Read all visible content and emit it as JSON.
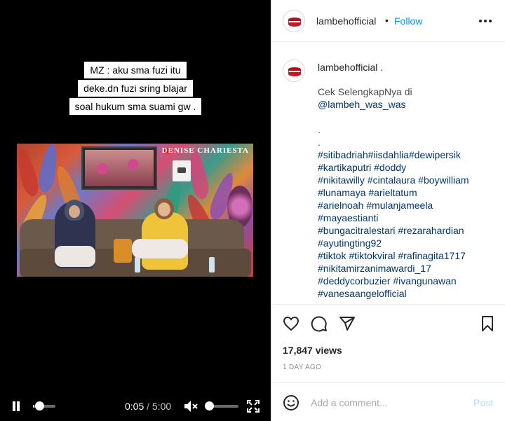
{
  "video": {
    "caption_lines": [
      "MZ : aku sma fuzi itu",
      "deke.dn fuzi sring blajar",
      "soal hukum sma suami gw ."
    ],
    "channel_watermark": "DENISE CHARIESTA",
    "current_time": "0:05",
    "separator": "/",
    "duration": "5:00",
    "progress_fraction": 0.017,
    "volume_level": 0,
    "muted": true,
    "icons": {
      "play_pause": "pause-icon",
      "volume": "mute-icon",
      "fullscreen": "fullscreen-icon"
    }
  },
  "header": {
    "username": "lambehofficial",
    "dot": "•",
    "follow_label": "Follow",
    "more_icon": "more-options-icon"
  },
  "post": {
    "username": "lambehofficial .",
    "lines": [
      {
        "text": "Cek SelengkapNya di",
        "kind": "text"
      },
      {
        "text": "@lambeh_was_was",
        "kind": "mention"
      },
      {
        "text": "",
        "kind": "gap"
      },
      {
        "text": ".",
        "kind": "text"
      },
      {
        "text": ".",
        "kind": "text"
      },
      {
        "text": "#sitibadriah#iisdahlia#dewipersik",
        "kind": "tag"
      },
      {
        "text": "#kartikaputri #doddy",
        "kind": "tag"
      },
      {
        "text": "#nikitawilly #cintalaura #boywilliam",
        "kind": "tag"
      },
      {
        "text": "#lunamaya #arieltatum",
        "kind": "tag"
      },
      {
        "text": "#arielnoah #mulanjameela",
        "kind": "tag"
      },
      {
        "text": "#mayaestianti",
        "kind": "tag"
      },
      {
        "text": "#bungacitralestari #rezarahardian",
        "kind": "tag"
      },
      {
        "text": "#ayutingting92",
        "kind": "tag"
      },
      {
        "text": "#tiktok #tiktokviral #rafinagita1717",
        "kind": "tag"
      },
      {
        "text": "#nikitamirzanimawardi_17",
        "kind": "tag"
      },
      {
        "text": "#deddycorbuzier #ivangunawan",
        "kind": "tag"
      },
      {
        "text": "#vanesaangelofficial",
        "kind": "tag"
      }
    ]
  },
  "actions": {
    "icons": [
      "like-icon",
      "comment-icon",
      "share-icon",
      "save-icon"
    ],
    "views": "17,847 views",
    "posted_ago": "1 DAY AGO"
  },
  "comment_box": {
    "emoji_icon": "emoji-icon",
    "placeholder": "Add a comment...",
    "post_label": "Post"
  },
  "colors": {
    "accent": "#0095f6",
    "post_disabled": "#b2dffc",
    "hashtag": "#00376b"
  }
}
